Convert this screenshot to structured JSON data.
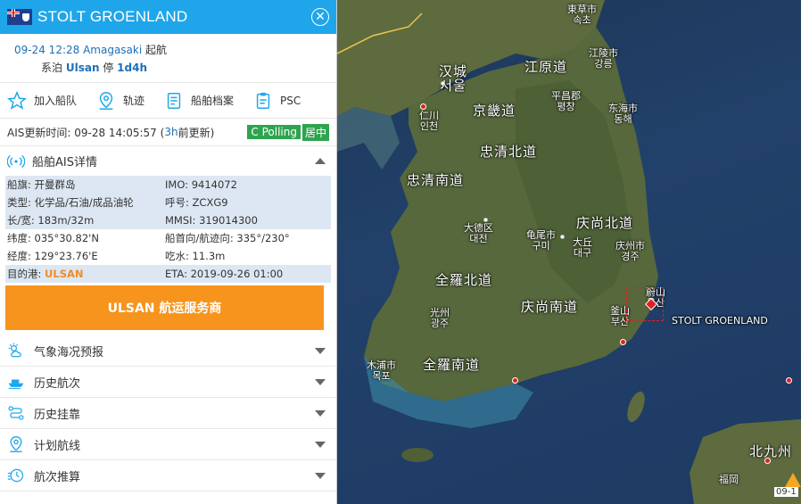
{
  "ship": {
    "name": "STOLT GROENLAND",
    "flag_icon": "cayman-islands-flag-icon"
  },
  "voyage": {
    "departed_time": "09-24 12:28 Amagasaki",
    "departed_label": "起航",
    "moored_prefix": "系泊",
    "moored_port": "Ulsan",
    "moored_mid": "停",
    "moored_duration": "1d4h"
  },
  "actions": [
    {
      "label": "加入船队",
      "icon": "star-icon"
    },
    {
      "label": "轨迹",
      "icon": "location-pin-icon"
    },
    {
      "label": "船舶档案",
      "icon": "document-icon"
    },
    {
      "label": "PSC",
      "icon": "clipboard-icon"
    }
  ],
  "ais": {
    "label": "AIS更新时间: 09-28 14:05:57 (",
    "ago": "3h",
    "suffix": " 前更新)",
    "badge1": "C Polling",
    "badge2": "居中"
  },
  "ais_section": {
    "title": "船舶AIS详情",
    "rows": [
      {
        "c1": "船旗: 开曼群岛",
        "c2": "IMO: 9414072"
      },
      {
        "c1": "类型: 化学品/石油/成品油轮",
        "c2": "呼号: ZCXG9"
      },
      {
        "c1": "长/宽: 183m/32m",
        "c2": "MMSI: 319014300"
      },
      {
        "c1": "纬度: 035°30.82'N",
        "c2": "船首向/航迹向: 335°/230°"
      },
      {
        "c1": "经度: 129°23.76'E",
        "c2": "吃水: 11.3m"
      }
    ],
    "dest_label": "目的港:",
    "dest_value": "ULSAN",
    "eta": "ETA: 2019-09-26 01:00"
  },
  "service_button": "ULSAN 航运服务商",
  "menu": [
    {
      "label": "气象海况预报",
      "icon": "weather-icon"
    },
    {
      "label": "历史航次",
      "icon": "ship-icon"
    },
    {
      "label": "历史挂靠",
      "icon": "route-icon"
    },
    {
      "label": "计划航线",
      "icon": "location-pin-icon"
    },
    {
      "label": "航次推算",
      "icon": "history-clock-icon"
    }
  ],
  "map": {
    "labels": {
      "tokusou": "東草市\n속초",
      "hanseong": "汉城\n서울",
      "gangwon": "江原道",
      "gangneung": "江陵市\n강릉",
      "pyeongchang": "平昌郡\n평창",
      "incheon": "仁川\n인천",
      "gyeonggi": "京畿道",
      "donghae": "东海市\n동해",
      "chungbuk": "忠清北道",
      "chungnam": "忠清南道",
      "daedeok": "大德区\n대전",
      "gumi": "龟尾市\n구미",
      "gyeongbuk": "庆尚北道",
      "daegu": "大丘\n대구",
      "gyeongju": "庆州市\n경주",
      "jeonbuk": "全羅北道",
      "ulsan": "蔚山\n울산",
      "ship_label": "STOLT GROENLAND",
      "gwangju": "光州\n광주",
      "gyeongnam": "庆尚南道",
      "busan": "釜山\n부산",
      "mokpo": "木浦市\n목포",
      "jeonnam": "全羅南道",
      "kitakyushu": "北九州",
      "fukuoka": "福岡",
      "warn_tag": "09-1"
    }
  }
}
